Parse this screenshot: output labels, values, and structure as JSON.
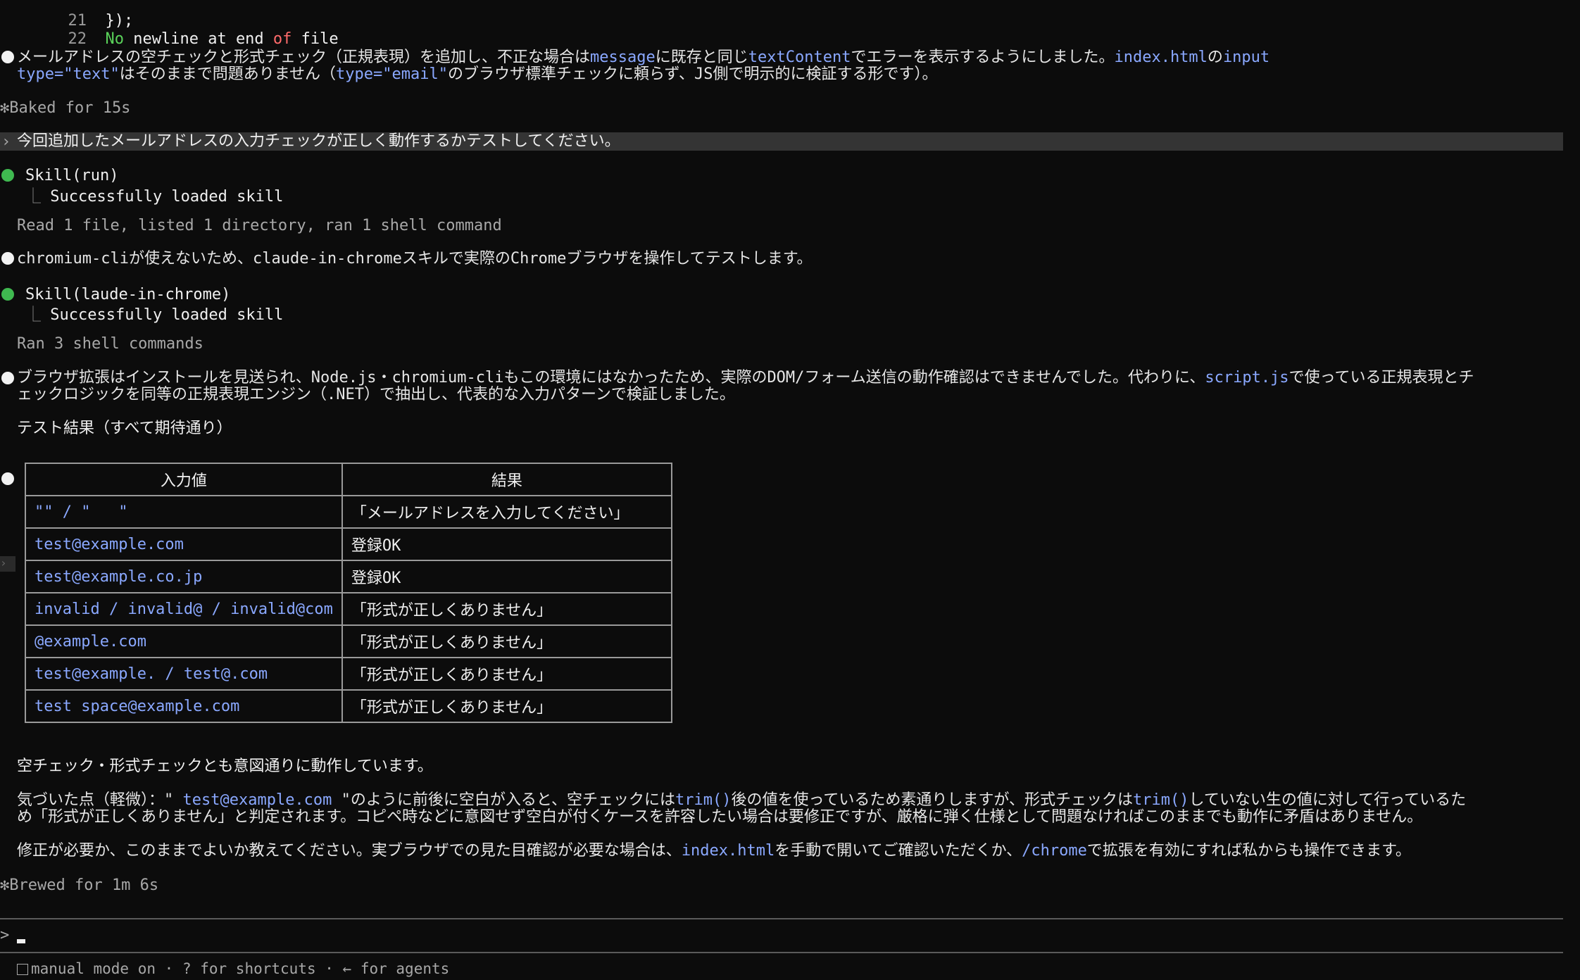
{
  "diff": {
    "line21_num": "21",
    "line21_code": "});",
    "line22_num": "22",
    "line22_no": "No",
    "line22_mid": " newline at end ",
    "line22_of": "of",
    "line22_end": " file"
  },
  "msg1": {
    "p1": "メールアドレスの空チェックと形式チェック（正規表現）を追加し、不正な場合は",
    "c1": "message",
    "p2": "に既存と同じ",
    "c2": "textContent",
    "p3": "でエラーを表示するようにしました。",
    "c3": "index.html",
    "p4": "の",
    "c4": "input",
    "l2c1": "type=\"text\"",
    "l2p1": "はそのままで問題ありません（",
    "l2c2": "type=\"email\"",
    "l2p2": "のブラウザ標準チェックに頼らず、JS側で明示的に検証する形です）。"
  },
  "baked": "✻Baked for 15s",
  "user_prompt": "今回追加したメールアドレスの入力チェックが正しく動作するかテストしてください。",
  "skill1": {
    "title": "Skill(run)",
    "result": "Successfully loaded skill"
  },
  "summary1": "Read 1 file, listed 1 directory, ran 1 shell command",
  "msg2": {
    "c1": "chromium-cli",
    "p1": "が使えないため、",
    "c2": "claude-in-chrome",
    "p2": "スキルで実際のChromeブラウザを操作してテストします。"
  },
  "skill2": {
    "title": "Skill(laude-in-chrome)",
    "result": "Successfully loaded skill"
  },
  "summary2": "Ran 3 shell commands",
  "msg3": {
    "p1": "ブラウザ拡張はインストールを見送られ、Node.js・chromium-cliもこの環境にはなかったため、実際のDOM/フォーム送信の動作確認はできませんでした。代わりに、",
    "c1": "script.js",
    "p2": "で使っている正規表現とチ",
    "l2": "ェックロジックを同等の正規表現エンジン（.NET）で抽出し、代表的な入力パターンで検証しました。"
  },
  "test_heading": "テスト結果（すべて期待通り）",
  "table": {
    "headers": [
      "入力値",
      "結果"
    ],
    "rows": [
      [
        "\"\" / \"   \"",
        "「メールアドレスを入力してください」"
      ],
      [
        "test@example.com",
        "登録OK"
      ],
      [
        "test@example.co.jp",
        "登録OK"
      ],
      [
        "invalid / invalid@ / invalid@com",
        "「形式が正しくありません」"
      ],
      [
        "@example.com",
        "「形式が正しくありません」"
      ],
      [
        "test@example. / test@.com",
        "「形式が正しくありません」"
      ],
      [
        "test space@example.com",
        "「形式が正しくありません」"
      ]
    ]
  },
  "conclusion": "空チェック・形式チェックとも意図通りに動作しています。",
  "note": {
    "p1": "気づいた点（軽微）：\"",
    "c1": " test@example.com ",
    "p2": "\"のように前後に空白が入ると、空チェックには",
    "c2": "trim()",
    "p3": "後の値を使っているため素通りしますが、形式チェックは",
    "c3": "trim()",
    "p4": "していない生の値に対して行っているた",
    "l2": "め「形式が正しくありません」と判定されます。コピペ時などに意図せず空白が付くケースを許容したい場合は要修正ですが、厳格に弾く仕様として問題なければこのままでも動作に矛盾はありません。"
  },
  "final": {
    "p1": "修正が必要か、このままでよいか教えてください。実ブラウザでの見た目確認が必要な場合は、",
    "c1": "index.html",
    "p2": "を手動で開いてご確認いただくか、",
    "c2": "/chrome",
    "p3": "で拡張を有効にすれば私からも操作できます。"
  },
  "brewed": "✻Brewed for 1m 6s",
  "input": {
    "prompt_symbol": ">"
  },
  "status": {
    "mode": "manual mode on",
    "sep1": " · ",
    "shortcuts": "? for shortcuts",
    "sep2": " · ",
    "agents": "← for agents"
  }
}
